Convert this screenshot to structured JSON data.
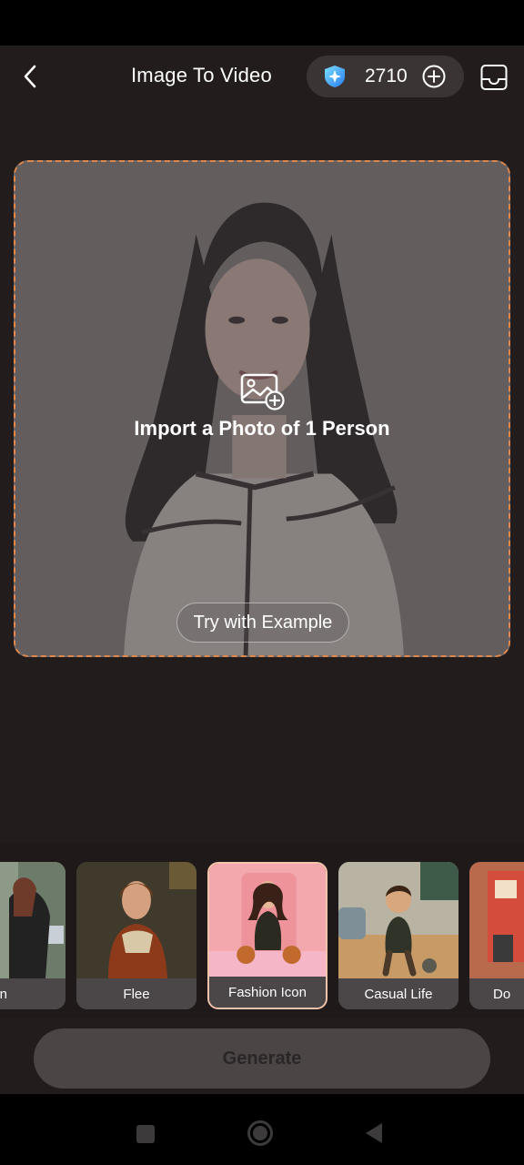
{
  "header": {
    "title": "Image To Video",
    "credits": "2710",
    "icons": {
      "back": "chevron-left-icon",
      "gem": "gem-badge-icon",
      "add": "plus-circle-icon",
      "inbox": "inbox-tray-icon"
    }
  },
  "upload": {
    "label": "Import a Photo of 1 Person",
    "try_example": "Try with Example",
    "icon": "image-add-icon",
    "border_color": "#e0884a"
  },
  "templates": [
    {
      "label": "n"
    },
    {
      "label": "Flee"
    },
    {
      "label": "Fashion Icon",
      "selected": true
    },
    {
      "label": "Casual Life"
    },
    {
      "label": "Do"
    }
  ],
  "generate": {
    "label": "Generate"
  },
  "colors": {
    "background": "#221d1c",
    "accent": "#e0884a",
    "selected_border": "#f4c4aa"
  }
}
